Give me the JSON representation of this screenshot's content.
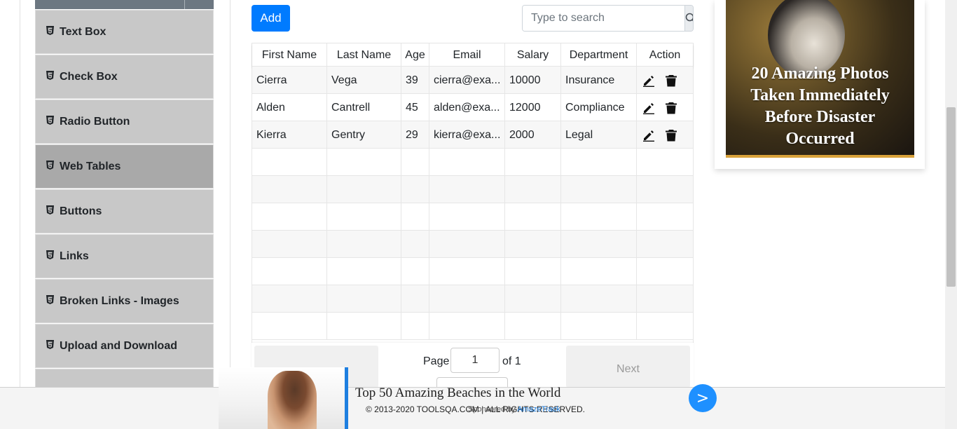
{
  "sidebar": {
    "items": [
      {
        "label": "Text Box"
      },
      {
        "label": "Check Box"
      },
      {
        "label": "Radio Button"
      },
      {
        "label": "Web Tables"
      },
      {
        "label": "Buttons"
      },
      {
        "label": "Links"
      },
      {
        "label": "Broken Links - Images"
      },
      {
        "label": "Upload and Download"
      }
    ],
    "active_index": 3
  },
  "toolbar": {
    "add_label": "Add",
    "search_placeholder": "Type to search"
  },
  "table": {
    "headers": [
      "First Name",
      "Last Name",
      "Age",
      "Email",
      "Salary",
      "Department",
      "Action"
    ],
    "rows": [
      {
        "first": "Cierra",
        "last": "Vega",
        "age": "39",
        "email": "cierra@exa...",
        "salary": "10000",
        "department": "Insurance"
      },
      {
        "first": "Alden",
        "last": "Cantrell",
        "age": "45",
        "email": "alden@exa...",
        "salary": "12000",
        "department": "Compliance"
      },
      {
        "first": "Kierra",
        "last": "Gentry",
        "age": "29",
        "email": "kierra@exa...",
        "salary": "2000",
        "department": "Legal"
      }
    ],
    "total_rows": 10
  },
  "pagination": {
    "page_label": "Page",
    "page_value": "1",
    "of_label": "of 1",
    "next_label": "Next"
  },
  "ad_right": {
    "title": "20 Amazing Photos Taken Immediately Before Disaster Occurred"
  },
  "ad_bottom": {
    "title": "Top 50 Amazing Beaches in the World",
    "sponsored_prefix": "Sponsored by",
    "sponsored_brand": "AmazeTrack",
    "next_label": ">"
  },
  "footer": {
    "text": "© 2013-2020 TOOLSQA.COM | ALL RIGHTS RESERVED."
  },
  "colors": {
    "primary": "#007bff",
    "sidebar_item": "#c8c8c8",
    "sidebar_active": "#a9a9a9",
    "ad_accent": "#1e7fe0"
  }
}
